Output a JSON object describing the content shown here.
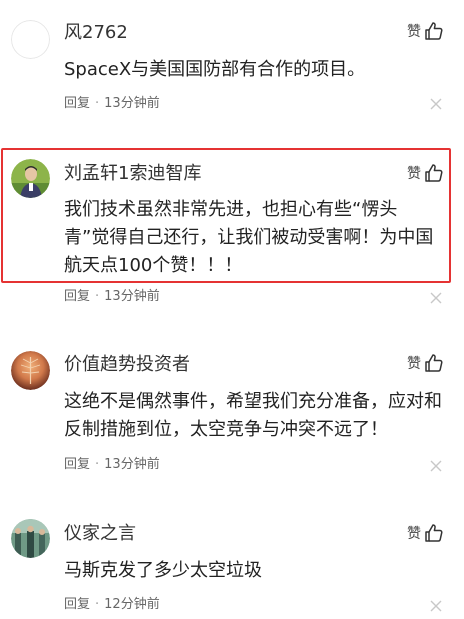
{
  "like_label": "赞",
  "reply_label": "回复",
  "comments": [
    {
      "username": "风2762",
      "text": "SpaceX与美国国防部有合作的项目。",
      "time": "13分钟前"
    },
    {
      "username": "刘孟轩1索迪智库",
      "text": "我们技术虽然非常先进，也担心有些“愣头青”觉得自己还行，让我们被动受害啊！为中国航天点100个赞！！！",
      "time": "13分钟前",
      "highlighted": true
    },
    {
      "username": "价值趋势投资者",
      "text": "这绝不是偶然事件，希望我们充分准备，应对和反制措施到位，太空竞争与冲突不远了！",
      "time": "13分钟前"
    },
    {
      "username": "仪家之言",
      "text": "马斯克发了多少太空垃圾",
      "time": "12分钟前"
    }
  ],
  "colors": {
    "highlight_border": "#e53333",
    "meta_text": "#666666"
  }
}
